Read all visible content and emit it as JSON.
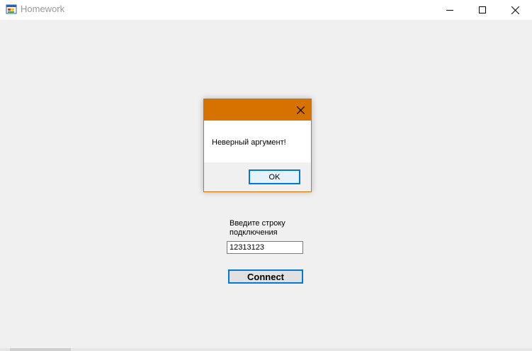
{
  "window": {
    "title": "Homework",
    "controls": {
      "minimize_icon": "minimize-icon",
      "maximize_icon": "maximize-icon",
      "close_icon": "close-icon"
    }
  },
  "form": {
    "label": "Введите строку подключения",
    "connection_value": "12313123",
    "connect_label": "Connect"
  },
  "dialog": {
    "message": "Неверный аргумент!",
    "ok_label": "OK",
    "accent_color": "#d67300"
  },
  "colors": {
    "focus_border": "#0078d7",
    "window_background": "#f0f0f0"
  }
}
